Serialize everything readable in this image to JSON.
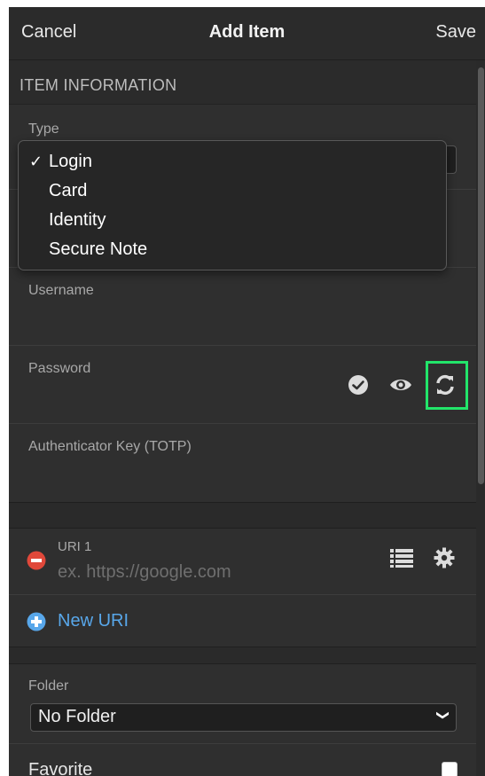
{
  "header": {
    "cancel_label": "Cancel",
    "title": "Add Item",
    "save_label": "Save"
  },
  "section_item_info": {
    "title": "ITEM INFORMATION"
  },
  "type_field": {
    "label": "Type",
    "options": [
      {
        "label": "Login",
        "selected": true
      },
      {
        "label": "Card",
        "selected": false
      },
      {
        "label": "Identity",
        "selected": false
      },
      {
        "label": "Secure Note",
        "selected": false
      }
    ]
  },
  "username": {
    "label": "Username"
  },
  "password": {
    "label": "Password"
  },
  "totp": {
    "label": "Authenticator Key (TOTP)"
  },
  "uri": {
    "label": "URI 1",
    "placeholder": "ex. https://google.com"
  },
  "new_uri": {
    "label": "New URI"
  },
  "folder": {
    "label": "Folder",
    "value": "No Folder"
  },
  "favorite": {
    "label": "Favorite",
    "checked": false
  },
  "colors": {
    "background": "#2f2f2f",
    "accent_link": "#58a7ea",
    "remove_red": "#e0483a",
    "highlight_green": "#22e56a"
  }
}
